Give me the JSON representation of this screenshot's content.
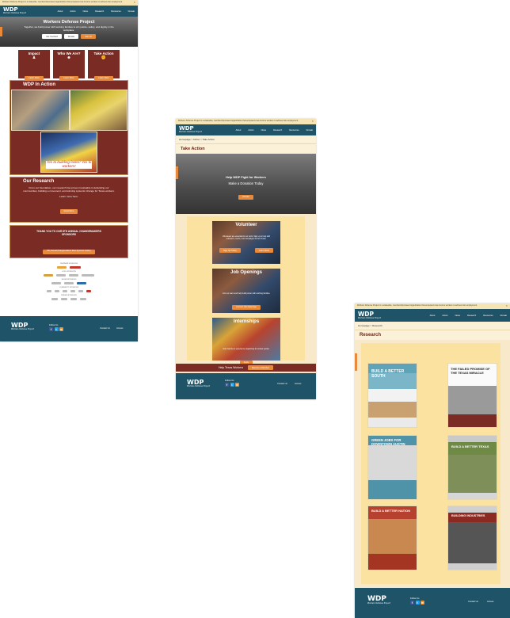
{
  "nav_items": [
    "About",
    "Action",
    "News",
    "Research",
    "Resources",
    "Donate"
  ],
  "logo": {
    "text": "WDP",
    "sub": "Workers Defense Project"
  },
  "home": {
    "notice": "Workers Defense Project is a statewide, membership-based organization that empowers low-income workers to achieve fair employment.",
    "hero_title": "Workers Defense Project",
    "hero_sub": "Together, we build power with working families to win justice, safety, and dignity in the workplace.",
    "hero_buttons": [
      "Get Involved",
      "Donate",
      "Join Us"
    ],
    "cards": [
      {
        "title": "Impact",
        "button": "Learn More"
      },
      {
        "title": "Who We Are?",
        "button": "Learn More"
      },
      {
        "title": "Take Action",
        "button": "Learn More"
      }
    ],
    "in_action_title": "WDP In Action",
    "sign_text": "Yes to building faster! Yes to workers!",
    "research_title": "Our Research",
    "research_text": "From our foundation, our research has proven invaluable in defending our communities, building a movement, and winning systemic change for Texas workers.",
    "research_more": "Learn more here:",
    "research_button": "Read More",
    "sponsors_title": "THANK YOU TO OUR 8TH ANNUAL CHANGEMAKERS SPONSORS",
    "sponsors_button": "8th Annual Changemakers Best Sponsor Listing",
    "sponsor_tiers": [
      "PLATINUM SPONSORS",
      "GOLD SPONSORS",
      "SILVER SPONSORS",
      "COMMUNITY SPONSORS",
      "FRIEND SPONSORS"
    ]
  },
  "take_action": {
    "notice": "Workers Defense Project is a statewide, membership-based organization that empowers low-income workers to achieve fair employment.",
    "crumbs": "Homepage > Action > Take Action",
    "title": "Take Action",
    "hero_line1": "Help WDP Fight for Workers",
    "hero_line2": "Make a Donation Today",
    "hero_button": "Donate",
    "cards": [
      {
        "title": "Volunteer",
        "text": "Volunteers are essential to our work. Sign up to help with outreach, events, and campaigns across Texas.",
        "buttons": [
          "Sign Up Today",
          "Learn More"
        ]
      },
      {
        "title": "Job Openings",
        "text": "Join our team and help build power with working families.",
        "buttons": [
          "Current Job Openings"
        ]
      },
      {
        "title": "Internships",
        "text": "Gain hands-on experience organizing for worker justice.",
        "buttons": [
          "Apply"
        ]
      }
    ],
    "bottom_banner": "Help Texas Workers",
    "bottom_button": "Become a Member"
  },
  "research": {
    "notice": "Workers Defense Project is a statewide, membership-based organization that empowers low-income workers to achieve fair employment.",
    "crumbs": "Homepage > Research",
    "title": "Research",
    "reports": [
      {
        "title": "BUILD A BETTER SOUTH"
      },
      {
        "title": "THE FAILED PROMISE OF THE TEXAS MIRACLE"
      },
      {
        "title": "GREEN JOBS FOR DOWNTOWN AUSTIN"
      },
      {
        "title": "BUILD A BETTER TEXAS"
      },
      {
        "title": "BUILD A BETTER NATION"
      },
      {
        "title": "BUILDING INDUSTRIES"
      }
    ]
  },
  "footer": {
    "follow": "Follow Us",
    "contact": "Contact Us",
    "access": "Access"
  }
}
